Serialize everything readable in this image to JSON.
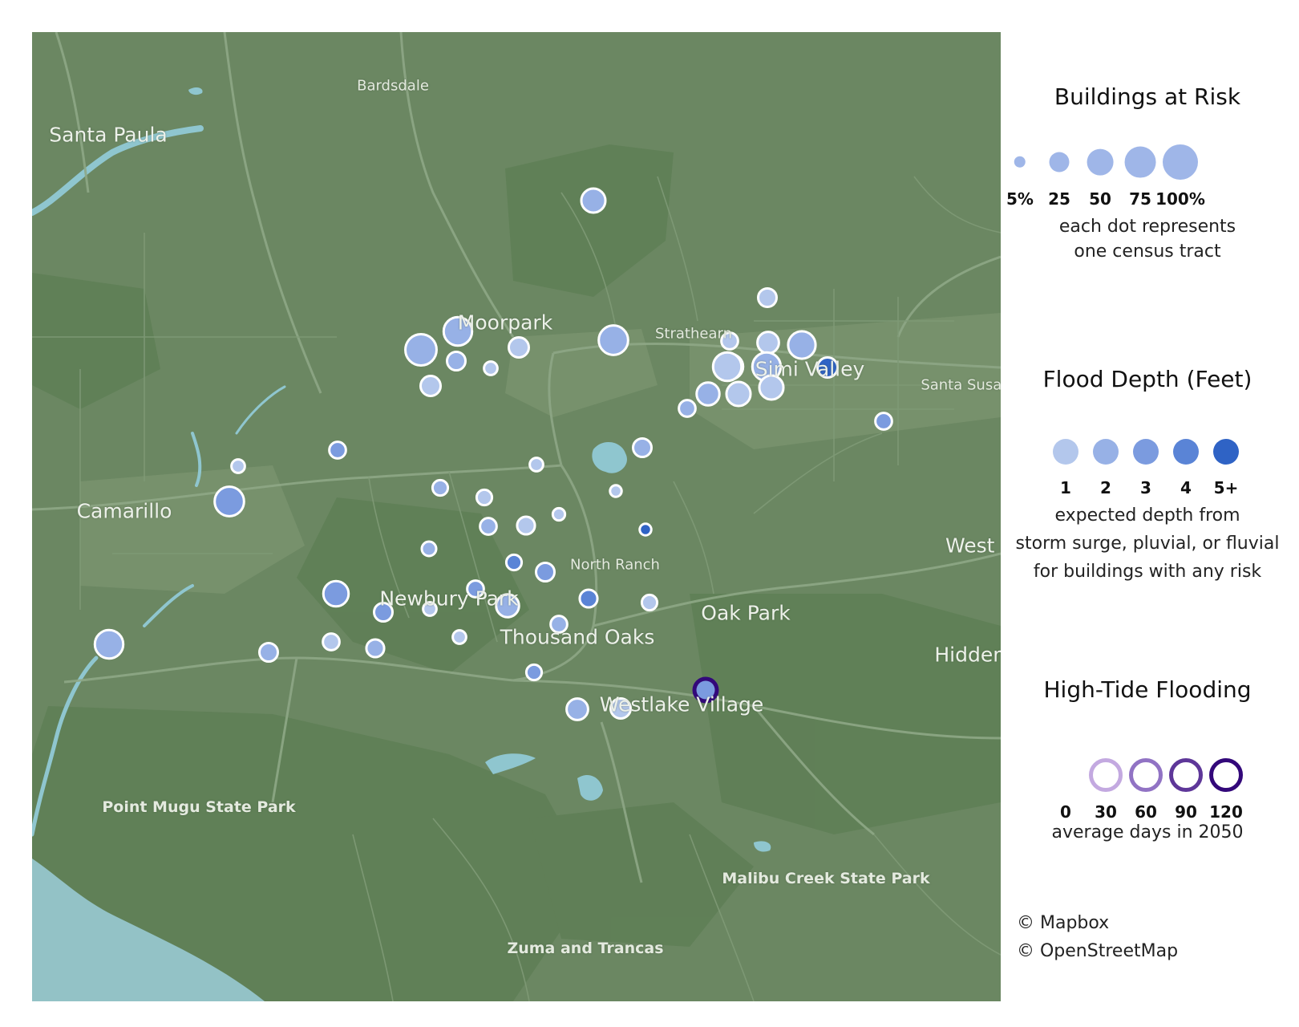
{
  "map": {
    "place_labels": [
      {
        "name": "Bardsdale",
        "cls": "town"
      },
      {
        "name": "Santa Paula",
        "cls": "city"
      },
      {
        "name": "Moorpark",
        "cls": "city"
      },
      {
        "name": "Strathearn",
        "cls": "town"
      },
      {
        "name": "Simi Valley",
        "cls": "city"
      },
      {
        "name": "Santa Susana",
        "cls": "town"
      },
      {
        "name": "Camarillo",
        "cls": "city"
      },
      {
        "name": "North Ranch",
        "cls": "town"
      },
      {
        "name": "Newbury Park",
        "cls": "city"
      },
      {
        "name": "Thousand Oaks",
        "cls": "city"
      },
      {
        "name": "Oak Park",
        "cls": "city"
      },
      {
        "name": "Westlake Village",
        "cls": "city"
      },
      {
        "name": "Point Mugu State Park",
        "cls": "park"
      },
      {
        "name": "Malibu Creek State Park",
        "cls": "park"
      },
      {
        "name": "Zuma and Trancas",
        "cls": "park"
      },
      {
        "name": "Hidden Hills",
        "cls": "city"
      },
      {
        "name": "West Hills",
        "cls": "city"
      }
    ],
    "tracts": [
      {
        "buildings_pct": 40,
        "depth": 2
      },
      {
        "buildings_pct": 20,
        "depth": 1
      },
      {
        "buildings_pct": 60,
        "depth": 2
      },
      {
        "buildings_pct": 75,
        "depth": 2
      },
      {
        "buildings_pct": 25,
        "depth": 1
      },
      {
        "buildings_pct": 20,
        "depth": 2
      },
      {
        "buildings_pct": 8,
        "depth": 1
      },
      {
        "buildings_pct": 25,
        "depth": 1
      },
      {
        "buildings_pct": 65,
        "depth": 2
      },
      {
        "buildings_pct": 55,
        "depth": 2
      },
      {
        "buildings_pct": 30,
        "depth": 1
      },
      {
        "buildings_pct": 15,
        "depth": 1
      },
      {
        "buildings_pct": 45,
        "depth": 1
      },
      {
        "buildings_pct": 60,
        "depth": 1
      },
      {
        "buildings_pct": 60,
        "depth": 2
      },
      {
        "buildings_pct": 40,
        "depth": 1
      },
      {
        "buildings_pct": 40,
        "depth": 1
      },
      {
        "buildings_pct": 35,
        "depth": 2
      },
      {
        "buildings_pct": 25,
        "depth": 5
      },
      {
        "buildings_pct": 15,
        "depth": 3
      },
      {
        "buildings_pct": 15,
        "depth": 2
      },
      {
        "buildings_pct": 20,
        "depth": 2
      },
      {
        "buildings_pct": 8,
        "depth": 1
      },
      {
        "buildings_pct": 15,
        "depth": 3
      },
      {
        "buildings_pct": 65,
        "depth": 3
      },
      {
        "buildings_pct": 8,
        "depth": 1
      },
      {
        "buildings_pct": 12,
        "depth": 2
      },
      {
        "buildings_pct": 12,
        "depth": 1
      },
      {
        "buildings_pct": 5,
        "depth": 1
      },
      {
        "buildings_pct": 6,
        "depth": 1
      },
      {
        "buildings_pct": 15,
        "depth": 2
      },
      {
        "buildings_pct": 18,
        "depth": 1
      },
      {
        "buildings_pct": 5,
        "depth": 5
      },
      {
        "buildings_pct": 10,
        "depth": 2
      },
      {
        "buildings_pct": 12,
        "depth": 4
      },
      {
        "buildings_pct": 20,
        "depth": 3
      },
      {
        "buildings_pct": 15,
        "depth": 3
      },
      {
        "buildings_pct": 45,
        "depth": 3
      },
      {
        "buildings_pct": 35,
        "depth": 2
      },
      {
        "buildings_pct": 18,
        "depth": 4
      },
      {
        "buildings_pct": 12,
        "depth": 1
      },
      {
        "buildings_pct": 8,
        "depth": 1
      },
      {
        "buildings_pct": 20,
        "depth": 3
      },
      {
        "buildings_pct": 15,
        "depth": 2
      },
      {
        "buildings_pct": 15,
        "depth": 1
      },
      {
        "buildings_pct": 8,
        "depth": 1
      },
      {
        "buildings_pct": 60,
        "depth": 2
      },
      {
        "buildings_pct": 20,
        "depth": 2
      },
      {
        "buildings_pct": 18,
        "depth": 2
      },
      {
        "buildings_pct": 30,
        "depth": 2
      },
      {
        "buildings_pct": 25,
        "depth": 1
      },
      {
        "buildings_pct": 12,
        "depth": 3
      },
      {
        "buildings_pct": 20,
        "depth": 3,
        "high_tide_days": 120
      }
    ]
  },
  "legend": {
    "size": {
      "title": "Buildings at Risk",
      "ticks": [
        "5%",
        "25",
        "50",
        "75",
        "100%"
      ],
      "values": [
        5,
        25,
        50,
        75,
        100
      ],
      "caption_line1": "each dot represents",
      "caption_line2": "one census tract"
    },
    "depth": {
      "title": "Flood Depth (Feet)",
      "ticks": [
        "1",
        "2",
        "3",
        "4",
        "5+"
      ],
      "colors": [
        "#b3c7ec",
        "#97b1e6",
        "#7b9bdf",
        "#5a84d6",
        "#2f63c5"
      ],
      "caption_line1": "expected depth from",
      "caption_line2": "storm surge, pluvial, or fluvial",
      "caption_line3": "for buildings with any risk"
    },
    "tide": {
      "title": "High-Tide Flooding",
      "ticks": [
        "0",
        "30",
        "60",
        "90",
        "120"
      ],
      "colors": [
        "#ffffff",
        "#c3a9e0",
        "#9173c4",
        "#5e3799",
        "#33087a"
      ],
      "caption": "average days in 2050"
    }
  },
  "attribution": {
    "mapbox": "© Mapbox",
    "osm": "© OpenStreetMap"
  }
}
